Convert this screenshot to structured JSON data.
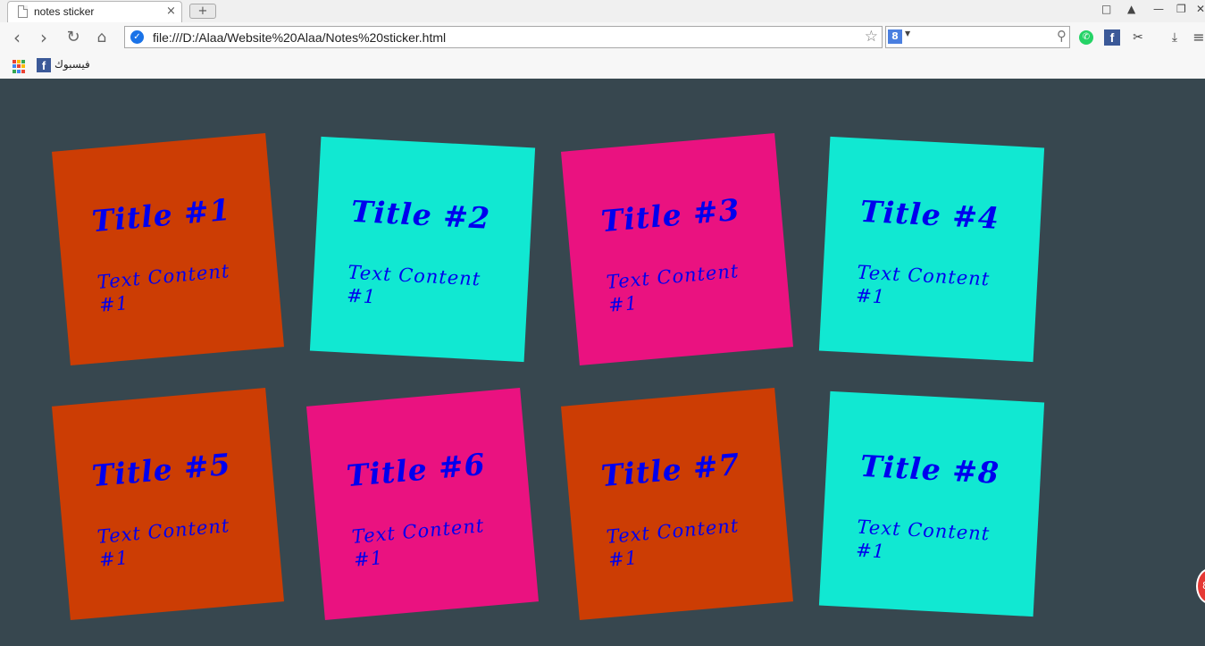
{
  "browser": {
    "tab_title": "notes sticker",
    "tab_close": "×",
    "new_tab": "+",
    "url": "file:///D:/Alaa/Website%20Alaa/Notes%20sticker.html",
    "search_engine_icon": "8",
    "bookmark_label": "فيسبوك",
    "fb_glyph": "f",
    "colors": {
      "chrome": "#f2f2f2",
      "secure": "#1a73e8",
      "facebook": "#3b5998"
    },
    "icons": [
      "back-icon",
      "forward-icon",
      "reload-icon",
      "home-icon",
      "secure-icon",
      "star-icon",
      "search-icon",
      "whatsapp-icon",
      "facebook-icon",
      "scissors-icon",
      "download-icon",
      "menu-icon",
      "apps-icon"
    ]
  },
  "notes": [
    {
      "title": "Title #1",
      "content": "Text Content #1",
      "color": "#cc3d04"
    },
    {
      "title": "Title #2",
      "content": "Text Content #1",
      "color": "#11e8d2"
    },
    {
      "title": "Title #3",
      "content": "Text Content #1",
      "color": "#ea1280"
    },
    {
      "title": "Title #4",
      "content": "Text Content #1",
      "color": "#11e8d2"
    },
    {
      "title": "Title #5",
      "content": "Text Content #1",
      "color": "#cc3d04"
    },
    {
      "title": "Title #6",
      "content": "Text Content #1",
      "color": "#ea1280"
    },
    {
      "title": "Title #7",
      "content": "Text Content #1",
      "color": "#cc3d04"
    },
    {
      "title": "Title #8",
      "content": "Text Content #1",
      "color": "#11e8d2"
    }
  ],
  "page": {
    "background": "#37474f",
    "text_color": "#0000ee"
  }
}
